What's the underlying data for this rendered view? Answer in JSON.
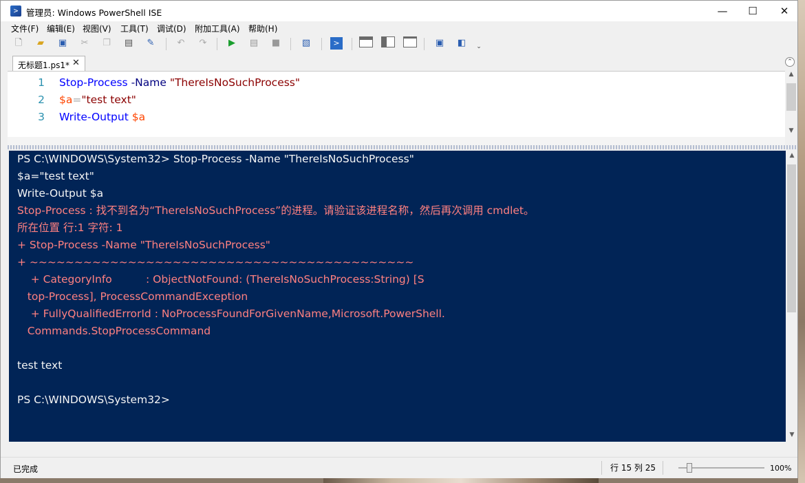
{
  "window": {
    "title": "管理员: Windows PowerShell ISE",
    "minimize": "—",
    "maximize": "☐",
    "close": "✕"
  },
  "menu": [
    "文件(F)",
    "编辑(E)",
    "视图(V)",
    "工具(T)",
    "调试(D)",
    "附加工具(A)",
    "帮助(H)"
  ],
  "toolbar": {
    "icons": [
      "new-script-icon",
      "open-icon",
      "save-icon",
      "cut-icon",
      "copy-icon",
      "paste-icon",
      "clear-console-icon",
      "undo-icon",
      "redo-icon",
      "run-script-icon",
      "run-selection-icon",
      "stop-icon",
      "remote-powershell-icon",
      "powershell-console-icon",
      "show-script-pane-top-icon",
      "show-script-pane-right-icon",
      "show-script-pane-maximized-icon",
      "show-command-window-icon",
      "show-command-addon-icon"
    ],
    "overflow": "⌄"
  },
  "tab": {
    "label": "无标题1.ps1*",
    "close": "✕"
  },
  "editor": {
    "lines": [
      {
        "num": "1",
        "tokens": [
          {
            "t": "Stop-Process",
            "c": "c-cmd"
          },
          {
            "t": " -Name ",
            "c": "c-param"
          },
          {
            "t": "\"ThereIsNoSuchProcess\"",
            "c": "c-str"
          }
        ]
      },
      {
        "num": "2",
        "tokens": [
          {
            "t": "$a",
            "c": "c-var"
          },
          {
            "t": "=",
            "c": "c-op"
          },
          {
            "t": "\"test text\"",
            "c": "c-str"
          }
        ]
      },
      {
        "num": "3",
        "tokens": [
          {
            "t": "Write-Output ",
            "c": "c-cmd"
          },
          {
            "t": "$a",
            "c": "c-var"
          }
        ]
      }
    ]
  },
  "console": {
    "lines": [
      {
        "text": "PS C:\\WINDOWS\\System32> Stop-Process -Name \"ThereIsNoSuchProcess\"",
        "err": false
      },
      {
        "text": "$a=\"test text\"",
        "err": false
      },
      {
        "text": "Write-Output $a",
        "err": false
      },
      {
        "text": "Stop-Process : 找不到名为“ThereIsNoSuchProcess”的进程。请验证该进程名称，然后再次调用 cmdlet。",
        "err": true
      },
      {
        "text": "所在位置 行:1 字符: 1",
        "err": true
      },
      {
        "text": "+ Stop-Process -Name \"ThereIsNoSuchProcess\"",
        "err": true
      },
      {
        "text": "+ ~~~~~~~~~~~~~~~~~~~~~~~~~~~~~~~~~~~~~~~~~~~",
        "err": true
      },
      {
        "text": "    + CategoryInfo          : ObjectNotFound: (ThereIsNoSuchProcess:String) [S",
        "err": true
      },
      {
        "text": "   top-Process], ProcessCommandException",
        "err": true
      },
      {
        "text": "    + FullyQualifiedErrorId : NoProcessFoundForGivenName,Microsoft.PowerShell.",
        "err": true
      },
      {
        "text": "   Commands.StopProcessCommand",
        "err": true
      },
      {
        "text": "",
        "err": false
      },
      {
        "text": "test text",
        "err": false
      },
      {
        "text": "",
        "err": false
      },
      {
        "text": "PS C:\\WINDOWS\\System32>",
        "err": false
      }
    ]
  },
  "status": {
    "text": "已完成",
    "position": "行 15  列 25",
    "zoom": "100%",
    "zoom_level_percent": 100
  },
  "colors": {
    "console_bg": "#012456",
    "console_fg": "#f5f5f5",
    "error_fg": "#ff8080"
  }
}
